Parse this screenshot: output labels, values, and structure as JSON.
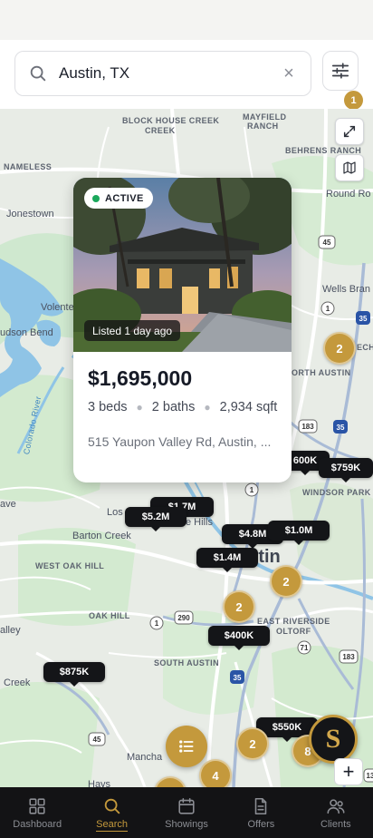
{
  "search": {
    "query": "Austin, TX",
    "filter_badge": "1"
  },
  "map": {
    "places": {
      "block_house_creek": "BLOCK HOUSE CREEK",
      "mayfield_ranch": "MAYFIELD RANCH",
      "behrens_ranch": "BEHRENS RANCH",
      "nameless": "NAMELESS",
      "round_rock": "Round Ro",
      "jonestown": "Jonestown",
      "volente": "Volente",
      "hudson_bend": "udson Bend",
      "wells_branch": "Wells Bran",
      "north_austin": "ORTH AUSTIN",
      "tech": "ECH",
      "colorado_river": "Colorado River",
      "windsor_park": "WINDSOR PARK",
      "lost_creek": "Los",
      "west_lake_hills": "e Hills",
      "barton_creek": "Barton Creek",
      "ave": "ave",
      "west_oak_hill": "WEST OAK HILL",
      "oak_hill": "OAK HILL",
      "austin": "ustin",
      "east_riverside": "EAST RIVERSIDE",
      "oltorf": "OLTORF",
      "valley": "alley",
      "south_austin": "SOUTH AUSTIN",
      "creek": "Creek",
      "manchaca": "Mancha",
      "hays": "Hays"
    },
    "highway_shields": [
      "45",
      "1",
      "35",
      "183",
      "35",
      "1",
      "290",
      "71",
      "183",
      "1",
      "35",
      "45",
      "13"
    ],
    "price_pins": {
      "p600k": "600K",
      "p759k": "$759K",
      "p17m": "$1.7M",
      "p52m": "$5.2M",
      "p48m": "$4.8M",
      "p10m": "$1.0M",
      "p14m": "$1.4M",
      "p400k": "$400K",
      "p875k": "$875K",
      "p550k": "$550K"
    },
    "clusters": {
      "c_north": "2",
      "c_austin": "2",
      "c_central": "2",
      "c_south": "2",
      "c_bottom": "4",
      "c_partial": "8"
    }
  },
  "listing_card": {
    "status": "ACTIVE",
    "listed": "Listed 1 day ago",
    "price": "$1,695,000",
    "beds": "3 beds",
    "baths": "2 baths",
    "sqft": "2,934 sqft",
    "address": "515 Yaupon Valley Rd, Austin, ..."
  },
  "avatar": {
    "initial": "S"
  },
  "zoom": {
    "plus": "+"
  },
  "tabbar": {
    "items": [
      {
        "label": "Dashboard",
        "icon": "dashboard-icon"
      },
      {
        "label": "Search",
        "icon": "search-icon"
      },
      {
        "label": "Showings",
        "icon": "calendar-icon"
      },
      {
        "label": "Offers",
        "icon": "document-icon"
      },
      {
        "label": "Clients",
        "icon": "users-icon"
      }
    ],
    "active": "Search"
  },
  "colors": {
    "accent": "#c4993c",
    "pin": "#141518",
    "active_dot": "#1aa85b",
    "tabbar": "#131315"
  }
}
